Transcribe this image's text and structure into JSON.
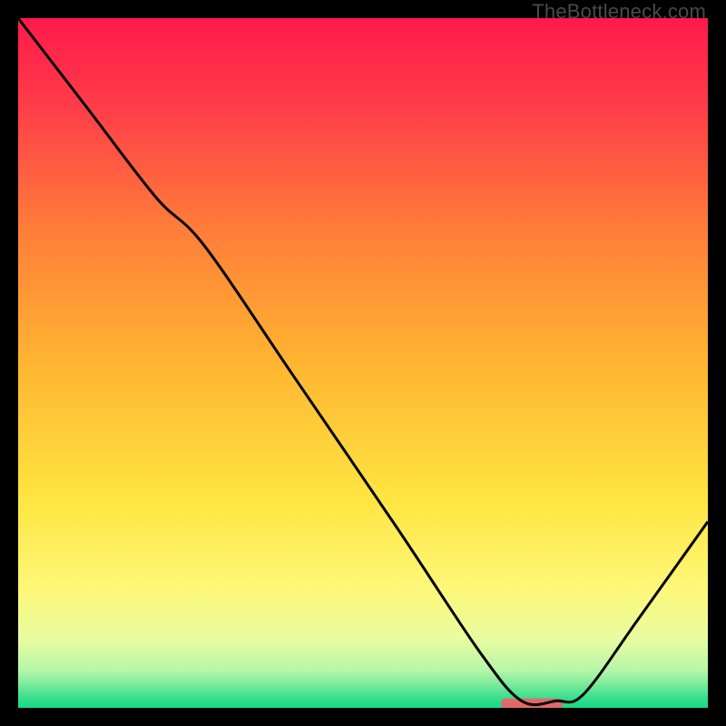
{
  "watermark": "TheBottleneck.com",
  "chart_data": {
    "type": "line",
    "title": "",
    "xlabel": "",
    "ylabel": "",
    "xlim": [
      0,
      100
    ],
    "ylim": [
      0,
      100
    ],
    "series": [
      {
        "name": "bottleneck-curve",
        "x": [
          0,
          10,
          20,
          27,
          40,
          55,
          67,
          73,
          78,
          82,
          90,
          100
        ],
        "y": [
          100,
          87,
          74,
          67,
          48,
          26,
          8,
          1,
          1,
          2,
          13,
          27
        ]
      }
    ],
    "highlight_segment": {
      "x0": 70,
      "x1": 79,
      "y": 0.7
    },
    "background_gradient": {
      "stops": [
        {
          "offset": 0.0,
          "color": "#ff1a4b"
        },
        {
          "offset": 0.12,
          "color": "#ff3a4a"
        },
        {
          "offset": 0.3,
          "color": "#ff7b3a"
        },
        {
          "offset": 0.5,
          "color": "#ffb531"
        },
        {
          "offset": 0.7,
          "color": "#ffe642"
        },
        {
          "offset": 0.83,
          "color": "#fdf87a"
        },
        {
          "offset": 0.9,
          "color": "#e8fca0"
        },
        {
          "offset": 0.945,
          "color": "#b7f7a8"
        },
        {
          "offset": 0.965,
          "color": "#7eeb9c"
        },
        {
          "offset": 0.985,
          "color": "#3adf8e"
        },
        {
          "offset": 1.0,
          "color": "#16d884"
        }
      ]
    },
    "curve_color": "#000000",
    "highlight_color": "#e06a6a"
  }
}
